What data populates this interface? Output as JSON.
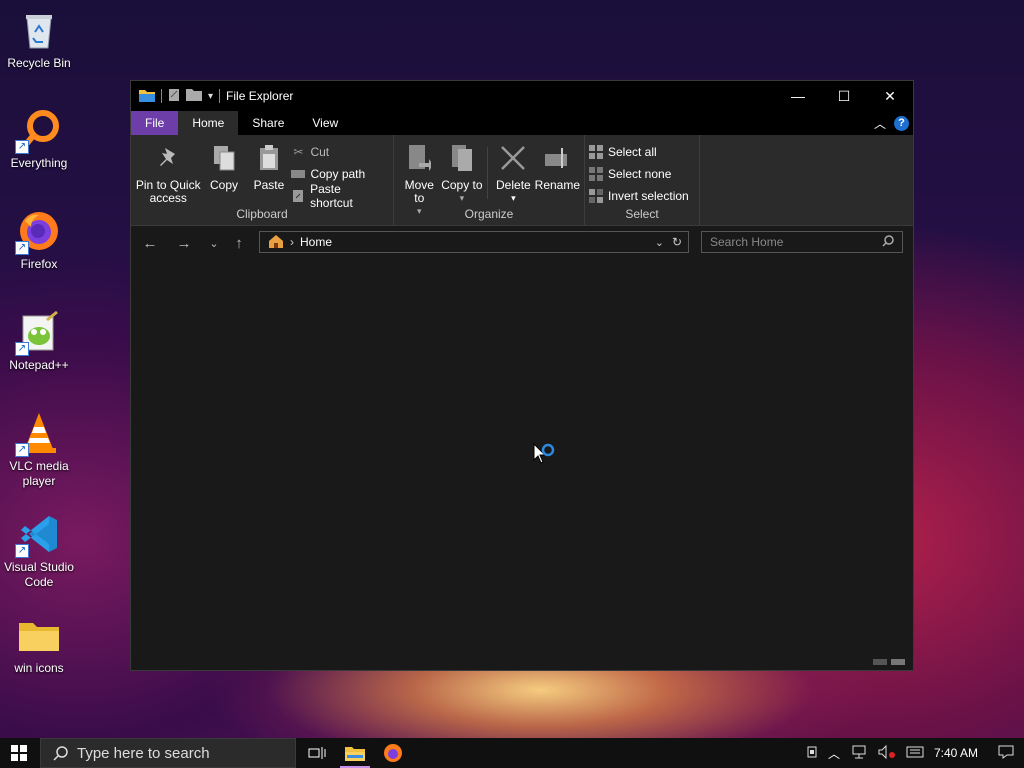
{
  "desktop": {
    "icons": [
      {
        "label": "Recycle Bin"
      },
      {
        "label": "Everything"
      },
      {
        "label": "Firefox"
      },
      {
        "label": "Notepad++"
      },
      {
        "label": "VLC media player"
      },
      {
        "label": "Visual Studio Code"
      },
      {
        "label": "win icons"
      }
    ]
  },
  "window": {
    "title": "File Explorer",
    "tabs": {
      "file": "File",
      "home": "Home",
      "share": "Share",
      "view": "View"
    },
    "help": "?",
    "ribbon": {
      "clipboard": {
        "pin": "Pin to Quick access",
        "copy": "Copy",
        "paste": "Paste",
        "cut": "Cut",
        "copy_path": "Copy path",
        "paste_shortcut": "Paste shortcut",
        "group": "Clipboard"
      },
      "organize": {
        "move_to": "Move to",
        "copy_to": "Copy to",
        "delete": "Delete",
        "rename": "Rename",
        "group": "Organize"
      },
      "select": {
        "select_all": "Select all",
        "select_none": "Select none",
        "invert": "Invert selection",
        "group": "Select"
      }
    },
    "address": {
      "location": "Home"
    },
    "search": {
      "placeholder": "Search Home"
    }
  },
  "taskbar": {
    "search_placeholder": "Type here to search",
    "time": "7:40 AM"
  },
  "colors": {
    "file_tab": "#6d3ea8",
    "accent_blue": "#1e6fd0"
  }
}
